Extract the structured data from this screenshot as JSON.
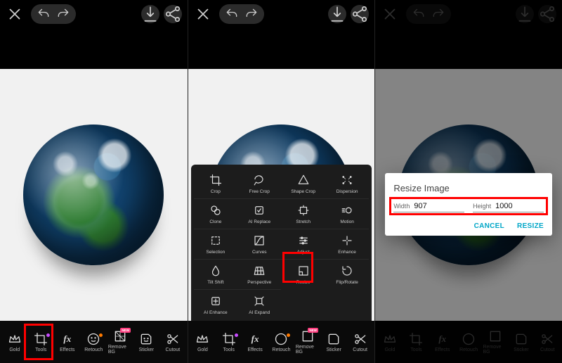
{
  "nav": {
    "gold": "Gold",
    "tools": "Tools",
    "effects": "Effects",
    "retouch": "Retouch",
    "removebg": "Remove BG",
    "sticker": "Sticker",
    "cutout": "Cutout"
  },
  "badges": {
    "new": "NEW"
  },
  "tools_popup": {
    "crop": "Crop",
    "freecrop": "Free Crop",
    "shapecrop": "Shape Crop",
    "dispersion": "Dispersion",
    "clone": "Clone",
    "aireplace": "AI Replace",
    "stretch": "Stretch",
    "motion": "Motion",
    "selection": "Selection",
    "curves": "Curves",
    "adjust": "Adjust",
    "enhance": "Enhance",
    "tiltshift": "Tilt Shift",
    "perspective": "Perspective",
    "resize": "Resize",
    "fliprotate": "Flip/Rotate",
    "aienhance": "AI Enhance",
    "aiexpand": "AI Expand"
  },
  "dialog": {
    "title": "Resize Image",
    "width_label": "Width",
    "width_value": "907",
    "height_label": "Height",
    "height_value": "1000",
    "cancel": "CANCEL",
    "resize": "RESIZE"
  }
}
